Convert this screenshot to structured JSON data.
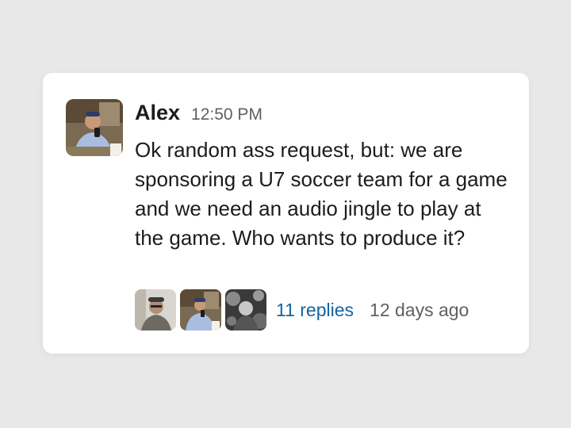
{
  "message": {
    "author": "Alex",
    "time": "12:50 PM",
    "text": "Ok random ass request, but: we are sponsoring a U7 soccer team for a game and we need an audio jingle to play at the game. Who wants to produce it?",
    "avatar_icon": "user-photo-icon"
  },
  "thread": {
    "replies_label": "11 replies",
    "last_reply": "12 days ago",
    "participant_icons": [
      "participant-photo-icon",
      "participant-photo-icon",
      "participant-photo-icon"
    ]
  },
  "colors": {
    "background": "#e8e8e8",
    "card": "#ffffff",
    "text": "#1d1c1d",
    "muted": "#616061",
    "link": "#1264a3"
  }
}
